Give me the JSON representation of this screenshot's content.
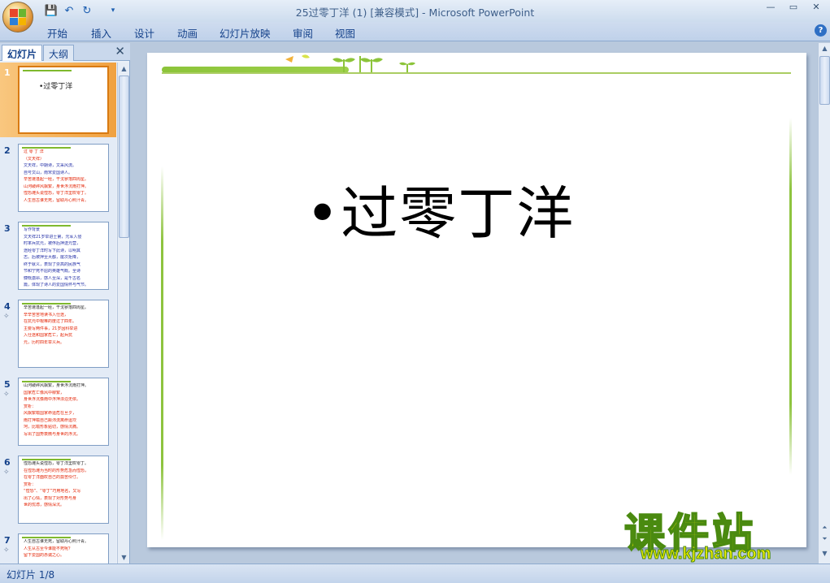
{
  "app": {
    "title": "25过零丁洋 (1) [兼容模式] - Microsoft PowerPoint"
  },
  "quick_access": {
    "icons": [
      "save-icon",
      "undo-icon",
      "redo-icon",
      "customize-icon"
    ],
    "glyphs": [
      "💾",
      "↶",
      "↻",
      "▾"
    ]
  },
  "window_controls": {
    "minimize": "—",
    "maximize": "▭",
    "close": "✕"
  },
  "ribbon": {
    "tabs": [
      "开始",
      "插入",
      "设计",
      "动画",
      "幻灯片放映",
      "审阅",
      "视图"
    ],
    "help_label": "?"
  },
  "pane": {
    "tab_slides": "幻灯片",
    "tab_outline": "大纲",
    "close": "✕",
    "slides": [
      {
        "num": "1",
        "anim": "",
        "lines": [
          {
            "t": "•过零丁洋",
            "c": "dark"
          }
        ]
      },
      {
        "num": "2",
        "anim": "",
        "lines": [
          {
            "t": "过 零 丁 洋",
            "c": "red"
          },
          {
            "t": "（文天祥）",
            "c": "red"
          },
          {
            "t": "文天祥，中期诗，文采风流。",
            "c": "blue"
          },
          {
            "t": "自号文山，南宋爱国诗人。",
            "c": "blue"
          },
          {
            "t": "辛苦遭逢起一经，干戈寥落四周星。",
            "c": "red"
          },
          {
            "t": "山河破碎风飘絮，身世浮沉雨打萍。",
            "c": "red"
          },
          {
            "t": "惶恐滩头说惶恐，零丁洋里叹零丁。",
            "c": "red"
          },
          {
            "t": "人生自古谁无死，留取丹心照汗青。",
            "c": "red"
          }
        ]
      },
      {
        "num": "3",
        "anim": "",
        "lines": [
          {
            "t": "写作背景",
            "c": "blue"
          },
          {
            "t": "文天祥21岁举进士第，元军入侵",
            "c": "blue"
          },
          {
            "t": "时率兵抗元，被俘后押送元营，",
            "c": "blue"
          },
          {
            "t": "途经零丁洋时写下此诗，以明其",
            "c": "blue"
          },
          {
            "t": "志。后被押至大都，屡次拒降，",
            "c": "blue"
          },
          {
            "t": "终于就义，表现了崇高的民族气",
            "c": "blue"
          },
          {
            "t": "节和宁死不屈的英雄气概。全诗",
            "c": "blue"
          },
          {
            "t": "慷慨激昂，感人至深，是千古名",
            "c": "blue"
          },
          {
            "t": "篇，体现了诗人的爱国情怀与气节。",
            "c": "blue"
          }
        ]
      },
      {
        "num": "4",
        "anim": "✧",
        "lines": [
          {
            "t": "辛苦遭逢起一经，干戈寥落四周星。",
            "c": "dark"
          },
          {
            "t": "辛辛苦苦地读书入仕途，",
            "c": "red"
          },
          {
            "t": "在抗元中艰难的度过了四年。",
            "c": "red"
          },
          {
            "t": "主要写两件事，21岁因科举进",
            "c": "red"
          },
          {
            "t": "入仕途和国家危亡，起兵抗",
            "c": "red"
          },
          {
            "t": "元，历时四年举义兵。",
            "c": "red"
          }
        ]
      },
      {
        "num": "5",
        "anim": "✧",
        "lines": [
          {
            "t": "山河破碎风飘絮，身世浮沉雨打萍。",
            "c": "dark"
          },
          {
            "t": "国家危亡像风中柳絮，",
            "c": "red"
          },
          {
            "t": "身世浮沉像雨中浮萍漂泊无依。",
            "c": "red"
          },
          {
            "t": "赏析：",
            "c": "red"
          },
          {
            "t": "风飘絮喻国家命运危在旦夕，",
            "c": "red"
          },
          {
            "t": "雨打萍喻自己颠沛流离命运坎",
            "c": "red"
          },
          {
            "t": "坷，比喻形象贴切，感情沉痛。",
            "c": "red"
          },
          {
            "t": "写出了国势衰微与身世的浮沉。",
            "c": "red"
          }
        ]
      },
      {
        "num": "6",
        "anim": "✧",
        "lines": [
          {
            "t": "惶恐滩头说惶恐，零丁洋里叹零丁。",
            "c": "dark"
          },
          {
            "t": "在惶恐滩为当时的形势危急而惶恐，",
            "c": "red"
          },
          {
            "t": "在零丁洋面叹自己的孤苦伶仃。",
            "c": "red"
          },
          {
            "t": "赏析：",
            "c": "red"
          },
          {
            "t": "“惶恐”、“零丁”巧用地名，又写",
            "c": "red"
          },
          {
            "t": "出了心情，表现了对形势与身",
            "c": "red"
          },
          {
            "t": "世的忧虑，感情深沉。",
            "c": "red"
          }
        ]
      },
      {
        "num": "7",
        "anim": "✧",
        "lines": [
          {
            "t": "人生自古谁无死，留取丹心照汗青。",
            "c": "dark"
          },
          {
            "t": "人生从古至今谁能不死呢？",
            "c": "red"
          },
          {
            "t": "留下爱国的赤诚之心。",
            "c": "red"
          }
        ]
      }
    ]
  },
  "slide": {
    "title": "•过零丁洋"
  },
  "watermark": {
    "cn": "课件站",
    "url": "www.kjzhan.com"
  },
  "status": {
    "text": "幻灯片 1/8"
  },
  "colors": {
    "accent_green": "#8cc43a",
    "selected_orange": "#f0a140",
    "ribbon_text": "#15428b"
  }
}
